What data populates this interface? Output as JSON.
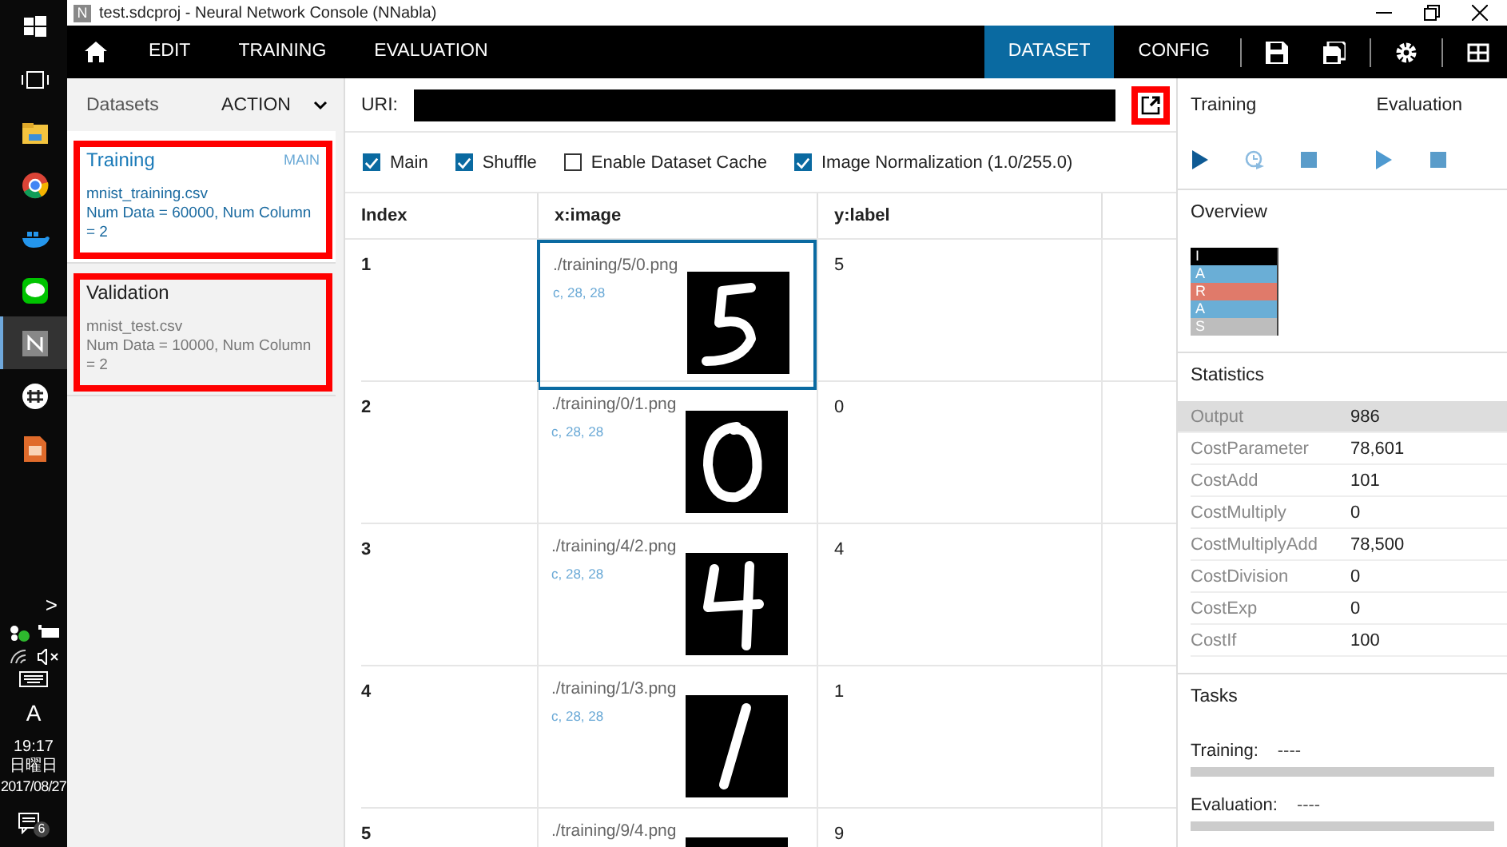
{
  "taskbar": {
    "apps": [
      {
        "kind": "windows"
      },
      {
        "kind": "taskview"
      },
      {
        "kind": "folder"
      },
      {
        "kind": "chrome"
      },
      {
        "kind": "docker"
      },
      {
        "kind": "line"
      },
      {
        "kind": "nnc",
        "selected": true
      },
      {
        "kind": "slack"
      },
      {
        "kind": "impress"
      }
    ],
    "chevron": ">",
    "ime": "A",
    "time": "19:17",
    "weekday": "日曜日",
    "date": "2017/08/27",
    "notifications": "6"
  },
  "window": {
    "app_icon": "N",
    "title": "test.sdcproj - Neural Network Console (NNabla)"
  },
  "menu": {
    "tabs": [
      {
        "label": "EDIT",
        "selected": false
      },
      {
        "label": "TRAINING",
        "selected": false
      },
      {
        "label": "EVALUATION",
        "selected": false
      }
    ],
    "right_tabs": [
      {
        "label": "DATASET",
        "selected": true
      },
      {
        "label": "CONFIG",
        "selected": false
      }
    ]
  },
  "datasets": {
    "title": "Datasets",
    "action": "ACTION",
    "items": [
      {
        "name": "Training",
        "badge": "MAIN",
        "file": "mnist_training.csv",
        "info": "Num Data = 60000, Num Column = 2",
        "selected": true,
        "highlighted": true
      },
      {
        "name": "Validation",
        "file": "mnist_test.csv",
        "info": "Num Data = 10000, Num Column = 2",
        "selected": false,
        "highlighted": true
      }
    ]
  },
  "uri": {
    "label": "URI:",
    "open_highlighted": true
  },
  "options": [
    {
      "label": "Main",
      "checked": true
    },
    {
      "label": "Shuffle",
      "checked": true
    },
    {
      "label": "Enable Dataset Cache",
      "checked": false
    },
    {
      "label": "Image Normalization (1.0/255.0)",
      "checked": true
    }
  ],
  "table": {
    "columns": [
      "Index",
      "x:image",
      "y:label"
    ],
    "rows": [
      {
        "index": "1",
        "path": "./training/5/0.png",
        "shape": "c, 28, 28",
        "label": "5",
        "selected": true
      },
      {
        "index": "2",
        "path": "./training/0/1.png",
        "shape": "c, 28, 28",
        "label": "0",
        "selected": false
      },
      {
        "index": "3",
        "path": "./training/4/2.png",
        "shape": "c, 28, 28",
        "label": "4",
        "selected": false
      },
      {
        "index": "4",
        "path": "./training/1/3.png",
        "shape": "c, 28, 28",
        "label": "1",
        "selected": false
      },
      {
        "index": "5",
        "path": "./training/9/4.png",
        "label": "9",
        "selected": false
      }
    ]
  },
  "run": {
    "training_label": "Training",
    "evaluation_label": "Evaluation"
  },
  "overview": {
    "title": "Overview",
    "layers": [
      {
        "letter": "I",
        "color": "#000000"
      },
      {
        "letter": "A",
        "color": "#6aaed6"
      },
      {
        "letter": "R",
        "color": "#e07a6a"
      },
      {
        "letter": "A",
        "color": "#6aaed6"
      },
      {
        "letter": "S",
        "color": "#bdbdbd"
      }
    ]
  },
  "statistics": {
    "title": "Statistics",
    "rows": [
      {
        "name": "Output",
        "value": "986",
        "selected": true
      },
      {
        "name": "CostParameter",
        "value": "78,601",
        "selected": false
      },
      {
        "name": "CostAdd",
        "value": "101",
        "selected": false
      },
      {
        "name": "CostMultiply",
        "value": "0",
        "selected": false
      },
      {
        "name": "CostMultiplyAdd",
        "value": "78,500",
        "selected": false
      },
      {
        "name": "CostDivision",
        "value": "0",
        "selected": false
      },
      {
        "name": "CostExp",
        "value": "0",
        "selected": false
      },
      {
        "name": "CostIf",
        "value": "100",
        "selected": false
      }
    ]
  },
  "tasks": {
    "title": "Tasks",
    "items": [
      {
        "label": "Training:",
        "status": "----",
        "level": 0
      },
      {
        "label": "Evaluation:",
        "status": "----",
        "level": 0
      }
    ]
  }
}
